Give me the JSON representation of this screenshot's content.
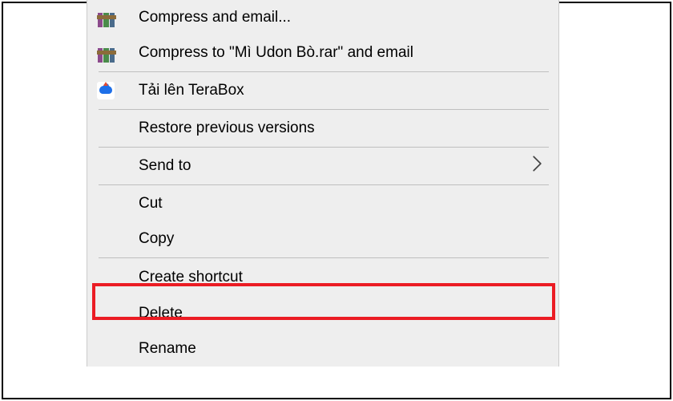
{
  "context_menu": {
    "items": [
      {
        "key": "compress-email",
        "icon": "winrar",
        "label": "Compress and email...",
        "has_arrow": false
      },
      {
        "key": "compress-named-email",
        "icon": "winrar",
        "label": "Compress to \"Mì Udon Bò.rar\" and email",
        "has_arrow": false
      },
      {
        "separator": true
      },
      {
        "key": "terabox-upload",
        "icon": "terabox",
        "label": "Tải lên TeraBox",
        "has_arrow": false
      },
      {
        "separator": true
      },
      {
        "key": "restore-versions",
        "icon": null,
        "label": "Restore previous versions",
        "has_arrow": false
      },
      {
        "separator": true
      },
      {
        "key": "send-to",
        "icon": null,
        "label": "Send to",
        "has_arrow": true
      },
      {
        "separator": true
      },
      {
        "key": "cut",
        "icon": null,
        "label": "Cut",
        "has_arrow": false
      },
      {
        "key": "copy",
        "icon": null,
        "label": "Copy",
        "has_arrow": false
      },
      {
        "separator": true
      },
      {
        "key": "create-shortcut",
        "icon": null,
        "label": "Create shortcut",
        "has_arrow": false,
        "highlighted": true
      },
      {
        "key": "delete",
        "icon": null,
        "label": "Delete",
        "has_arrow": false
      },
      {
        "key": "rename",
        "icon": null,
        "label": "Rename",
        "has_arrow": false
      }
    ]
  }
}
